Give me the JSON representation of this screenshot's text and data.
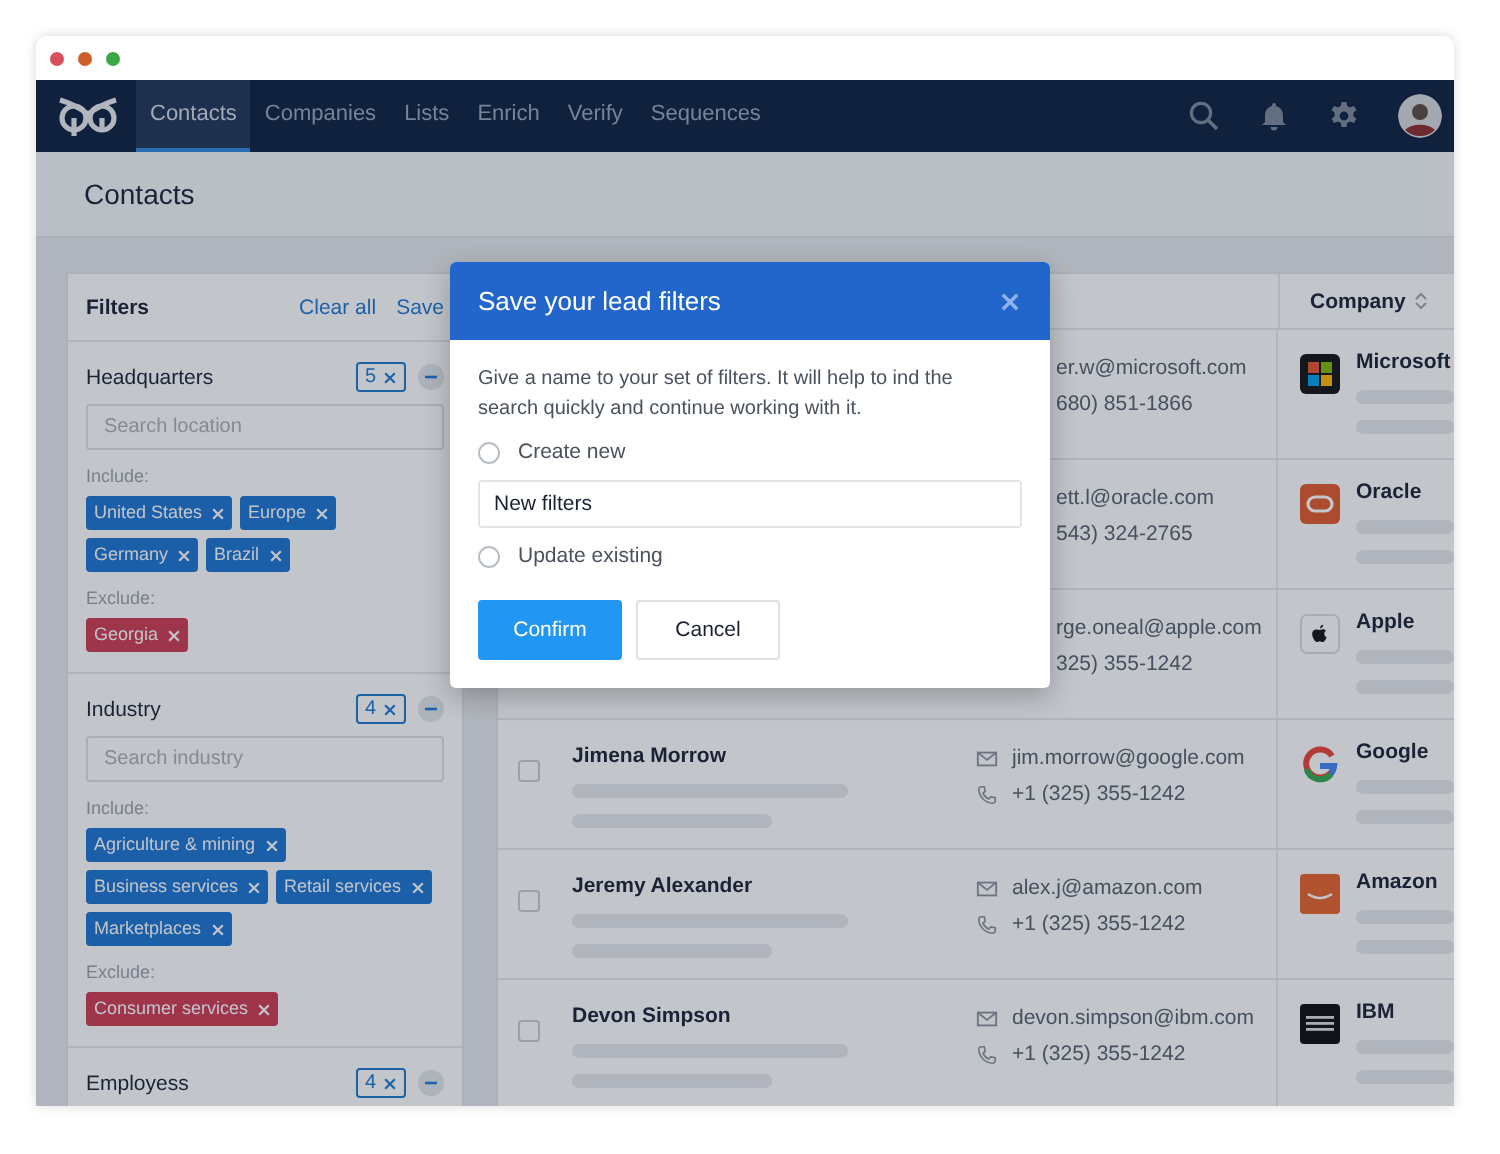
{
  "window": {
    "controls": [
      {
        "color": "#d8505a"
      },
      {
        "color": "#d0602a"
      },
      {
        "color": "#3aa845"
      }
    ]
  },
  "nav": {
    "tabs": [
      {
        "label": "Contacts",
        "selected": true
      },
      {
        "label": "Companies",
        "selected": false
      },
      {
        "label": "Lists",
        "selected": false
      },
      {
        "label": "Enrich",
        "selected": false
      },
      {
        "label": "Verify",
        "selected": false
      },
      {
        "label": "Sequences",
        "selected": false
      }
    ]
  },
  "page_title": "Contacts",
  "filters": {
    "title": "Filters",
    "clear_all": "Clear all",
    "save": "Save",
    "sections": [
      {
        "title": "Headquarters",
        "count": "5",
        "placeholder": "Search location",
        "include_label": "Include:",
        "include": [
          "United States",
          "Europe",
          "Germany",
          "Brazil"
        ],
        "exclude_label": "Exclude:",
        "exclude": [
          "Georgia"
        ]
      },
      {
        "title": "Industry",
        "count": "4",
        "placeholder": "Search industry",
        "include_label": "Include:",
        "include": [
          "Agriculture & mining",
          "Business services",
          "Retail services",
          "Marketplaces"
        ],
        "exclude_label": "Exclude:",
        "exclude": [
          "Consumer services"
        ]
      },
      {
        "title": "Employess",
        "count": "4"
      }
    ]
  },
  "table": {
    "columns": [
      {
        "label": "Company",
        "sortable": true
      }
    ],
    "rows": [
      {
        "email": "er.w@microsoft.com",
        "phone": "680) 851-1866",
        "company": "Microsoft"
      },
      {
        "email": "ett.l@oracle.com",
        "phone": "543) 324-2765",
        "company": "Oracle"
      },
      {
        "email": "rge.oneal@apple.com",
        "phone": "325) 355-1242",
        "company": "Apple"
      },
      {
        "name": "Jimena Morrow",
        "checked": false,
        "email": "jim.morrow@google.com",
        "phone": "+1 (325) 355-1242",
        "company": "Google"
      },
      {
        "name": "Jeremy Alexander",
        "checked": false,
        "email": "alex.j@amazon.com",
        "phone": "+1 (325) 355-1242",
        "company": "Amazon"
      },
      {
        "name": "Devon Simpson",
        "checked": false,
        "email": "devon.simpson@ibm.com",
        "phone": "+1 (325) 355-1242",
        "company": "IBM"
      }
    ]
  },
  "modal": {
    "title": "Save your lead filters",
    "description": "Give a name to your set of filters. It will help to ind the search quickly and continue working with it.",
    "fields": [
      {
        "kind": "radio",
        "label": "Create new",
        "selected": false
      },
      {
        "kind": "input",
        "value": "New filters"
      },
      {
        "kind": "radio",
        "label": "Update existing",
        "selected": false
      }
    ],
    "buttons": [
      {
        "label": "Confirm",
        "kind": "primary"
      },
      {
        "label": "Cancel",
        "kind": "secondary"
      }
    ]
  }
}
